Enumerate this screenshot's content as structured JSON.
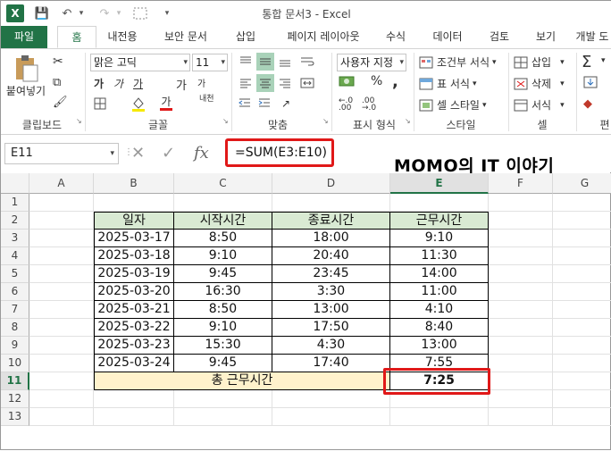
{
  "window": {
    "title": "통합 문서3 - Excel",
    "app_logo": "X"
  },
  "qat": {
    "save_icon": "💾",
    "undo_icon": "↶",
    "redo_icon": "↷",
    "more_icon": "▾"
  },
  "tabs": [
    "파일",
    "홈",
    "내전용",
    "보안 문서",
    "삽입",
    "페이지 레이아웃",
    "수식",
    "데이터",
    "검토",
    "보기",
    "개발 도"
  ],
  "ribbon": {
    "clipboard": {
      "paste_label": "붙여넣기",
      "group": "클립보드"
    },
    "font": {
      "name": "맑은 고딕",
      "size": "11",
      "group": "글꼴",
      "bold": "가",
      "italic": "가",
      "underline": "가",
      "grow": "가",
      "shrink": "가",
      "phonetic": "내천"
    },
    "alignment": {
      "group": "맞춤"
    },
    "number": {
      "format": "사용자 지정",
      "group": "표시 형식",
      "percent": "%",
      "comma": ","
    },
    "styles": {
      "conditional": "조건부 서식",
      "table": "표 서식",
      "cell": "셀 스타일",
      "group": "스타일"
    },
    "cells": {
      "insert": "삽입",
      "delete": "삭제",
      "format": "서식",
      "group": "셀"
    },
    "editing": {
      "group": "편"
    }
  },
  "formula_bar": {
    "name_box": "E11",
    "formula": "=SUM(E3:E10)",
    "fx": "fx"
  },
  "brand_text": "MOMO의 IT 이야기",
  "columns": [
    "A",
    "B",
    "C",
    "D",
    "E",
    "F",
    "G"
  ],
  "rows": [
    "1",
    "2",
    "3",
    "4",
    "5",
    "6",
    "7",
    "8",
    "9",
    "10",
    "11",
    "12",
    "13"
  ],
  "table": {
    "headers": [
      "일자",
      "시작시간",
      "종료시간",
      "근무시간"
    ],
    "rows": [
      [
        "2025-03-17",
        "8:50",
        "18:00",
        "9:10"
      ],
      [
        "2025-03-18",
        "9:10",
        "20:40",
        "11:30"
      ],
      [
        "2025-03-19",
        "9:45",
        "23:45",
        "14:00"
      ],
      [
        "2025-03-20",
        "16:30",
        "3:30",
        "11:00"
      ],
      [
        "2025-03-21",
        "8:50",
        "13:00",
        "4:10"
      ],
      [
        "2025-03-22",
        "9:10",
        "17:50",
        "8:40"
      ],
      [
        "2025-03-23",
        "15:30",
        "4:30",
        "13:00"
      ],
      [
        "2025-03-24",
        "9:45",
        "17:40",
        "7:55"
      ]
    ],
    "total_label": "총 근무시간",
    "total_value": "7:25"
  },
  "colors": {
    "excel_green": "#217346",
    "header_fill": "#d9ead3",
    "total_fill": "#fff2cc",
    "highlight_red": "#e01818"
  }
}
